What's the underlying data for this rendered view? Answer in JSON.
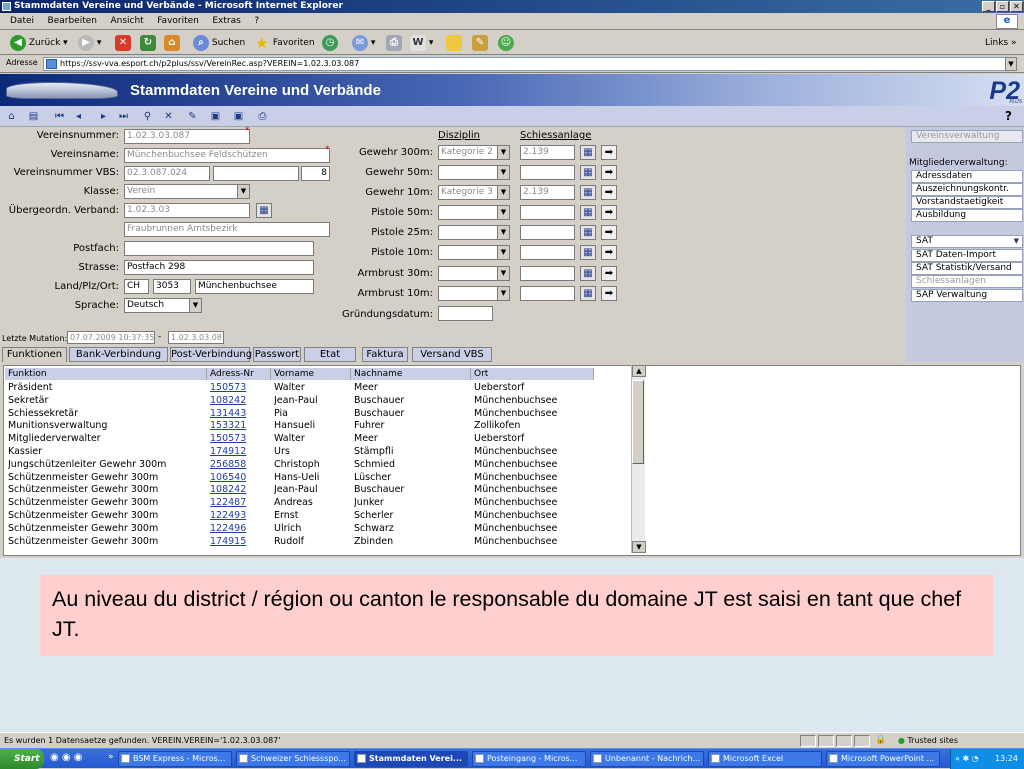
{
  "window": {
    "title": "Stammdaten Vereine und Verbände - Microsoft Internet Explorer"
  },
  "menu": [
    "Datei",
    "Bearbeiten",
    "Ansicht",
    "Favoriten",
    "Extras",
    "?"
  ],
  "browser_toolbar": {
    "back": "Zurück",
    "search": "Suchen",
    "favorites": "Favoriten",
    "links": "Links"
  },
  "address": {
    "label": "Adresse",
    "url": "https://ssv-vva.esport.ch/p2plus/ssv/VereinRec.asp?VEREIN=1.02.3.03.087"
  },
  "app": {
    "title": "Stammdaten Vereine und Verbände",
    "logo": "P2",
    "logo_sub": "PLUS",
    "help": "?"
  },
  "form": {
    "vereinsnummer_label": "Vereinsnummer:",
    "vereinsnummer": "1.02.3.03.087",
    "vereinsname_label": "Vereinsname:",
    "vereinsname": "Münchenbuchsee Feldschützen",
    "vbs_label": "Vereinsnummer VBS:",
    "vbs": "02.3.087.024",
    "vbs_extra": "8",
    "klasse_label": "Klasse:",
    "klasse": "Verein",
    "verband_label": "Übergeordn. Verband:",
    "verband": "1.02.3.03",
    "verband_name": "Fraubrunnen Amtsbezirk",
    "postfach_label": "Postfach:",
    "postfach": "",
    "strasse_label": "Strasse:",
    "strasse": "Postfach 298",
    "ort_label": "Land/Plz/Ort:",
    "land": "CH",
    "plz": "3053",
    "ort": "Münchenbuchsee",
    "sprache_label": "Sprache:",
    "sprache": "Deutsch",
    "mutation_label": "Letzte Mutation:",
    "mutation_date": "07.07.2009 10:37:35",
    "mutation_sep": "-",
    "mutation_by": "1.02.3.03.087"
  },
  "disziplin": {
    "header_disziplin": "Disziplin",
    "header_anlage": "Schiessanlage",
    "rows": [
      {
        "label": "Gewehr 300m:",
        "kategorie": "Kategorie 2",
        "anlage": "2.139"
      },
      {
        "label": "Gewehr 50m:",
        "kategorie": "",
        "anlage": ""
      },
      {
        "label": "Gewehr 10m:",
        "kategorie": "Kategorie 3",
        "anlage": "2.139"
      },
      {
        "label": "Pistole 50m:",
        "kategorie": "",
        "anlage": ""
      },
      {
        "label": "Pistole 25m:",
        "kategorie": "",
        "anlage": ""
      },
      {
        "label": "Pistole 10m:",
        "kategorie": "",
        "anlage": ""
      },
      {
        "label": "Armbrust 30m:",
        "kategorie": "",
        "anlage": ""
      },
      {
        "label": "Armbrust 10m:",
        "kategorie": "",
        "anlage": ""
      }
    ],
    "gruendung_label": "Gründungsdatum:",
    "gruendung": ""
  },
  "side": {
    "vereinsverwaltung": "Vereinsverwaltung",
    "mitglieder_label": "Mitgliederverwaltung:",
    "items": [
      "Adressdaten",
      "Auszeichnungskontr.",
      "Vorstandstaetigkeit",
      "Ausbildung"
    ],
    "sat": "SAT",
    "sat_items": [
      "SAT Daten-Import",
      "SAT Statistik/Versand",
      "Schiessanlagen",
      "SAP Verwaltung"
    ]
  },
  "tabs": [
    "Funktionen",
    "Bank-Verbindung",
    "Post-Verbindung",
    "Passwort",
    "Etat",
    "Faktura",
    "Versand VBS"
  ],
  "grid": {
    "columns": [
      "Funktion",
      "Adress-Nr",
      "Vorname",
      "Nachname",
      "Ort"
    ],
    "rows": [
      [
        "Präsident",
        "150573",
        "Walter",
        "Meer",
        "Ueberstorf"
      ],
      [
        "Sekretär",
        "108242",
        "Jean-Paul",
        "Buschauer",
        "Münchenbuchsee"
      ],
      [
        "Schiessekretär",
        "131443",
        "Pia",
        "Buschauer",
        "Münchenbuchsee"
      ],
      [
        "Munitionsverwaltung",
        "153321",
        "Hansueli",
        "Fuhrer",
        "Zollikofen"
      ],
      [
        "Mitgliederverwalter",
        "150573",
        "Walter",
        "Meer",
        "Ueberstorf"
      ],
      [
        "Kassier",
        "174912",
        "Urs",
        "Stämpfli",
        "Münchenbuchsee"
      ],
      [
        "Jungschützenleiter Gewehr 300m",
        "256858",
        "Christoph",
        "Schmied",
        "Münchenbuchsee"
      ],
      [
        "Schützenmeister Gewehr 300m",
        "106540",
        "Hans-Ueli",
        "Lüscher",
        "Münchenbuchsee"
      ],
      [
        "Schützenmeister Gewehr 300m",
        "108242",
        "Jean-Paul",
        "Buschauer",
        "Münchenbuchsee"
      ],
      [
        "Schützenmeister Gewehr 300m",
        "122487",
        "Andreas",
        "Junker",
        "Münchenbuchsee"
      ],
      [
        "Schützenmeister Gewehr 300m",
        "122493",
        "Ernst",
        "Scherler",
        "Münchenbuchsee"
      ],
      [
        "Schützenmeister Gewehr 300m",
        "122496",
        "Ulrich",
        "Schwarz",
        "Münchenbuchsee"
      ],
      [
        "Schützenmeister Gewehr 300m",
        "174915",
        "Rudolf",
        "Zbinden",
        "Münchenbuchsee"
      ]
    ]
  },
  "note": "Au niveau du district / région ou canton le responsable du domaine JT est saisi en tant que chef JT.",
  "status": {
    "text": "Es wurden 1 Datensaetze gefunden. VEREIN.VEREIN='1.02.3.03.087'",
    "zone": "Trusted sites"
  },
  "taskbar": {
    "start": "Start",
    "tasks": [
      "BSM Express - Micros...",
      "Schweizer Schiessspo...",
      "Stammdaten Verei...",
      "Posteingang - Micros...",
      "Unbenannt - Nachrich...",
      "Microsoft Excel",
      "Microsoft PowerPoint ..."
    ],
    "clock": "13:24"
  }
}
